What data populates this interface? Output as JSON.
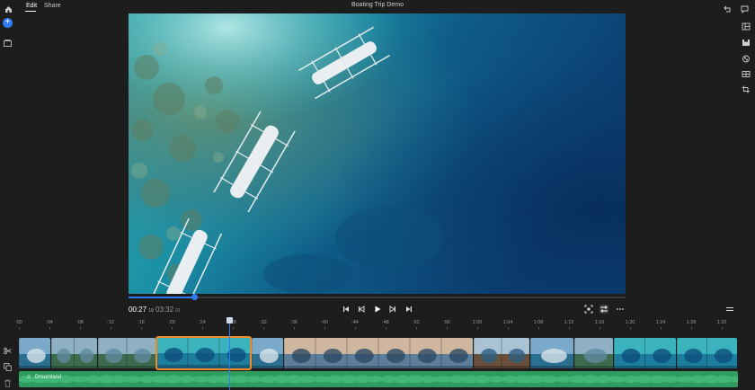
{
  "header": {
    "tabs": [
      {
        "label": "Edit",
        "active": true
      },
      {
        "label": "Share",
        "active": false
      }
    ],
    "project_title": "Boating Trip Demo"
  },
  "icons": {
    "home": "home-icon",
    "add_media": "plus-icon",
    "media_library": "media-library-icon",
    "undo": "undo-icon",
    "chat": "chat-icon",
    "right_rail": [
      "layout-icon",
      "save-icon",
      "color-icon",
      "transitions-icon",
      "crop-icon"
    ],
    "timeline_tools": [
      "scissors-icon",
      "duplicate-icon",
      "trash-icon"
    ]
  },
  "playback": {
    "current_time": "00:27",
    "current_frames": "19",
    "duration": "03:32",
    "duration_frames": "01",
    "progress": 0.132
  },
  "ruler": {
    "ticks": [
      ":00",
      ":04",
      ":08",
      ":12",
      ":16",
      ":20",
      ":24",
      ":28",
      ":32",
      ":36",
      ":40",
      ":44",
      ":48",
      ":52",
      ":56",
      "1:00",
      "1:04",
      "1:08",
      "1:12",
      "1:16",
      "1:20",
      "1:24",
      "1:28",
      "1:32"
    ]
  },
  "timeline": {
    "clips": [
      {
        "name": "clip-1",
        "start": 0,
        "width": 36,
        "scene": "sea"
      },
      {
        "name": "clip-2",
        "start": 36,
        "width": 52,
        "scene": "island"
      },
      {
        "name": "clip-3",
        "start": 88,
        "width": 65,
        "scene": "island"
      },
      {
        "name": "clip-4",
        "start": 153,
        "width": 106,
        "scene": "aerial",
        "selected": true
      },
      {
        "name": "clip-5",
        "start": 259,
        "width": 36,
        "scene": "sea"
      },
      {
        "name": "clip-6",
        "start": 295,
        "width": 211,
        "scene": "people"
      },
      {
        "name": "clip-7",
        "start": 506,
        "width": 63,
        "scene": "boat"
      },
      {
        "name": "clip-8",
        "start": 569,
        "width": 49,
        "scene": "sea"
      },
      {
        "name": "clip-9",
        "start": 618,
        "width": 44,
        "scene": "island"
      },
      {
        "name": "clip-10",
        "start": 662,
        "width": 70,
        "scene": "aerial"
      },
      {
        "name": "clip-11",
        "start": 732,
        "width": 68,
        "scene": "aerial"
      }
    ],
    "audio_track": {
      "label": "Dreamland"
    }
  },
  "colors": {
    "accent": "#2f7cf6",
    "selection": "#f08a24",
    "audio": "#2e9c5f",
    "background": "#1d1d1d"
  }
}
